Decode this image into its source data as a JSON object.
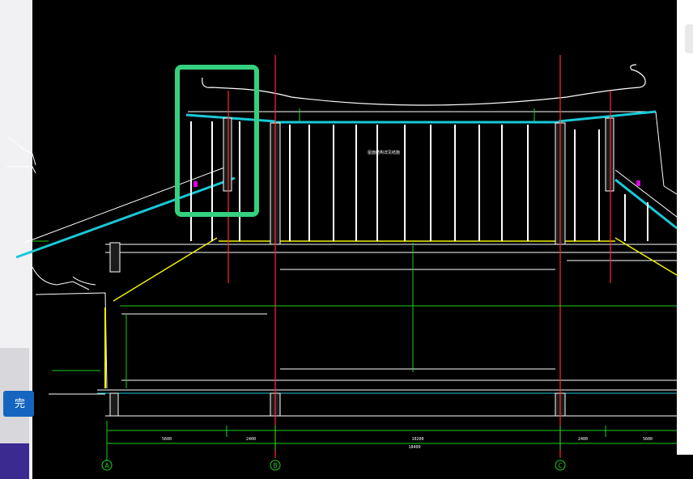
{
  "app": {
    "left_button_label": "完"
  },
  "drawing": {
    "axis_labels": [
      "A",
      "B",
      "C"
    ],
    "overall_dimension": "18400",
    "span_dimensions": [
      "5600",
      "2400",
      "10200",
      "2400",
      "5600"
    ],
    "annotation_text": "屋面结构详见结施"
  },
  "colors": {
    "background": "#000000",
    "outline": "#ffffff",
    "axis": "#ff2a2a",
    "dimension": "#19d11a",
    "roof": "#18c9d8",
    "accent": "#f0f000",
    "highlight": "#35d07f",
    "magenta": "#e000e0"
  }
}
